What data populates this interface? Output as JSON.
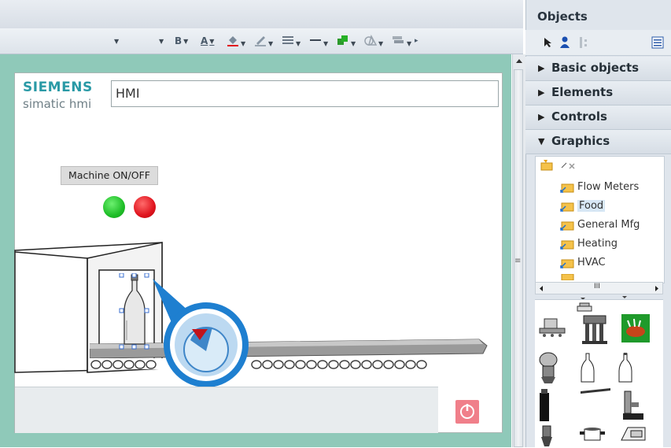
{
  "panel": {
    "title": "Objects",
    "sections": [
      {
        "label": "Basic objects",
        "expanded": false
      },
      {
        "label": "Elements",
        "expanded": false
      },
      {
        "label": "Controls",
        "expanded": false
      },
      {
        "label": "Graphics",
        "expanded": true
      }
    ],
    "graphics_folders": [
      "Flow Meters",
      "Food",
      "General Mfg",
      "Heating",
      "HVAC"
    ],
    "selected_folder": "Food",
    "scroll_mark": "III"
  },
  "toolbar": {
    "bold_label": "B",
    "font_color_label": "A"
  },
  "hmi": {
    "brand": "SIEMENS",
    "product": "simatic hmi",
    "title_field": "HMI",
    "machine_button": "Machine ON/OFF",
    "led_on_color": "#1fbe28",
    "led_off_color": "#e0141e",
    "accent_teal": "#8fc9b9"
  }
}
